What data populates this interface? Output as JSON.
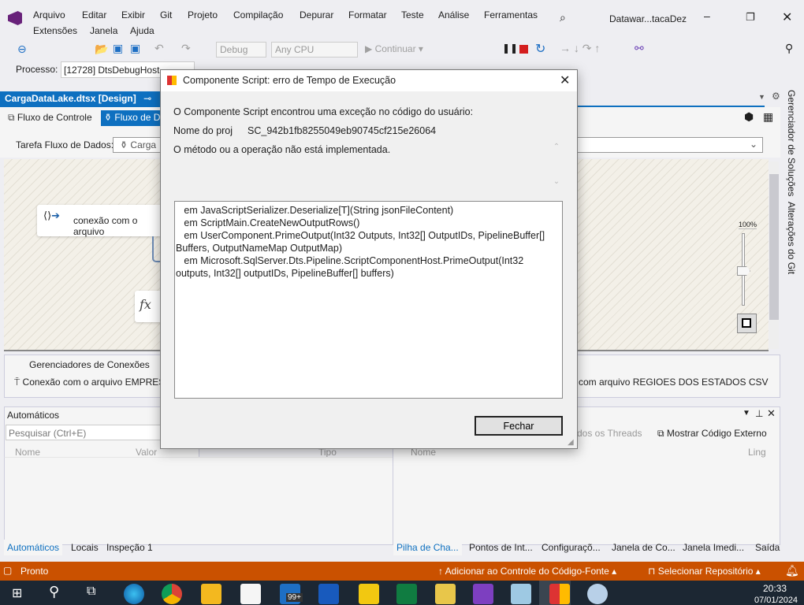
{
  "menu": {
    "items": [
      "Arquivo",
      "Editar",
      "Exibir",
      "Git",
      "Projeto",
      "Compilação",
      "Depurar",
      "Formatar",
      "Teste",
      "Análise",
      "Ferramentas",
      "Extensões",
      "Janela",
      "Ajuda"
    ],
    "solution_title": "Datawar...tacaDez"
  },
  "toolbar": {
    "config": "Debug",
    "platform": "Any CPU",
    "continue_label": "Continuar"
  },
  "process_bar": {
    "label": "Processo:",
    "value": "[12728] DtsDebugHost."
  },
  "doc_tab": {
    "title": "CargaDataLake.dtsx [Design]"
  },
  "designer_tabs": [
    {
      "label": "Fluxo de Controle"
    },
    {
      "label": "Fluxo de D"
    }
  ],
  "task_row": {
    "label": "Tarefa Fluxo de Dados:",
    "value": "Carga"
  },
  "canvas": {
    "component1": "conexão com o arquivo",
    "component2_icon": "fx",
    "zoom_label": "100%",
    "zoom_percent": 100
  },
  "connections": {
    "tab": "Gerenciadores de Conexões",
    "items": [
      "Conexão com o arquivo EMPRESA C",
      "com arquivo  REGIOES DOS ESTADOS CSV"
    ]
  },
  "autos": {
    "title": "Automáticos",
    "search_placeholder": "Pesquisar (Ctrl+E)",
    "columns": [
      "Nome",
      "Valor",
      "Tipo"
    ],
    "tabs": [
      "Automáticos",
      "Locais",
      "Inspeção 1"
    ]
  },
  "callstack": {
    "threads_label": "dos os Threads",
    "external_label": "Mostrar Código Externo",
    "columns": [
      "Nome",
      "Ling"
    ],
    "tabs": [
      "Pilha de Cha...",
      "Pontos de Int...",
      "Configuraçõ...",
      "Janela de Co...",
      "Janela Imedi...",
      "Saída"
    ]
  },
  "side_tabs": [
    "Gerenciador de Soluções",
    "Alterações do Git"
  ],
  "status": {
    "ready": "Pronto",
    "source_control": "Adicionar ao Controle do Código-Fonte",
    "repo": "Selecionar Repositório",
    "color": "#ca5100"
  },
  "taskbar": {
    "time": "20:33",
    "date": "07/01/2024",
    "mail_badge": "99+"
  },
  "dialog": {
    "title": "Componente Script: erro de Tempo de Execução",
    "line1": "O Componente Script encontrou uma exceção no código do usuário:",
    "project_label": "Nome  do proj",
    "project_value": "SC_942b1fb8255049eb90745cf215e26064",
    "message": "O método ou a operação não está implementada.",
    "stack_trace": "   em JavaScriptSerializer.Deserialize[T](String jsonFileContent)\n   em ScriptMain.CreateNewOutputRows()\n   em UserComponent.PrimeOutput(Int32 Outputs, Int32[] OutputIDs, PipelineBuffer[] Buffers, OutputNameMap OutputMap)\n   em Microsoft.SqlServer.Dts.Pipeline.ScriptComponentHost.PrimeOutput(Int32 outputs, Int32[] outputIDs, PipelineBuffer[] buffers)",
    "close_label": "Fechar"
  }
}
